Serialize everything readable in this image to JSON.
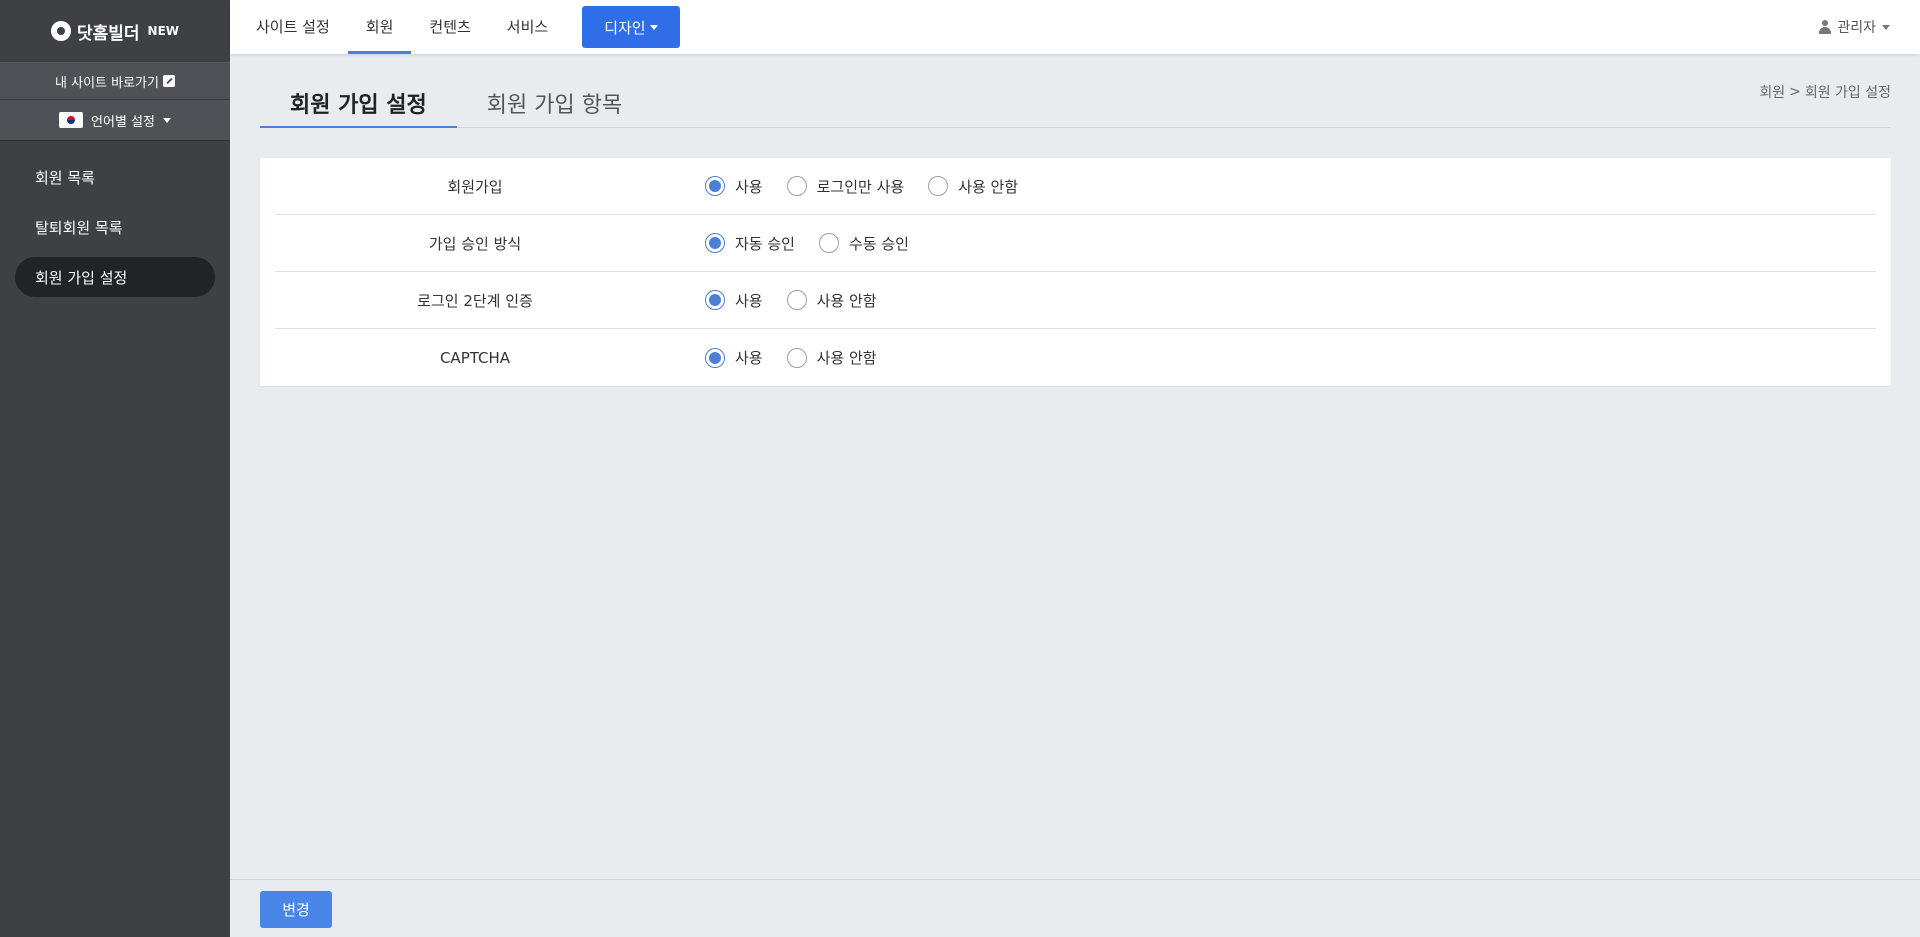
{
  "sidebar": {
    "logo_text": "닷홈빌더",
    "logo_badge": "NEW",
    "site_link": "내 사이트 바로가기",
    "language": "언어별 설정",
    "items": [
      {
        "label": "회원 목록"
      },
      {
        "label": "탈퇴회원 목록"
      },
      {
        "label": "회원 가입 설정"
      }
    ]
  },
  "topbar": {
    "tabs": [
      {
        "label": "사이트 설정"
      },
      {
        "label": "회원"
      },
      {
        "label": "컨텐츠"
      },
      {
        "label": "서비스"
      }
    ],
    "design_button": "디자인",
    "user_label": "관리자"
  },
  "page": {
    "tabs": [
      {
        "label": "회원 가입 설정"
      },
      {
        "label": "회원 가입 항목"
      }
    ],
    "breadcrumb": {
      "parent": "회원",
      "sep": ">",
      "current": "회원 가입 설정"
    }
  },
  "settings": [
    {
      "label": "회원가입",
      "options": [
        "사용",
        "로그인만 사용",
        "사용 안함"
      ]
    },
    {
      "label": "가입 승인 방식",
      "options": [
        "자동 승인",
        "수동 승인"
      ]
    },
    {
      "label": "로그인 2단계 인증",
      "options": [
        "사용",
        "사용 안함"
      ]
    },
    {
      "label": "CAPTCHA",
      "options": [
        "사용",
        "사용 안함"
      ]
    }
  ],
  "footer": {
    "save_label": "변경"
  },
  "colors": {
    "accent": "#4e7fd8",
    "design_button": "#2f6de9",
    "sidebar": "#3f4044"
  }
}
